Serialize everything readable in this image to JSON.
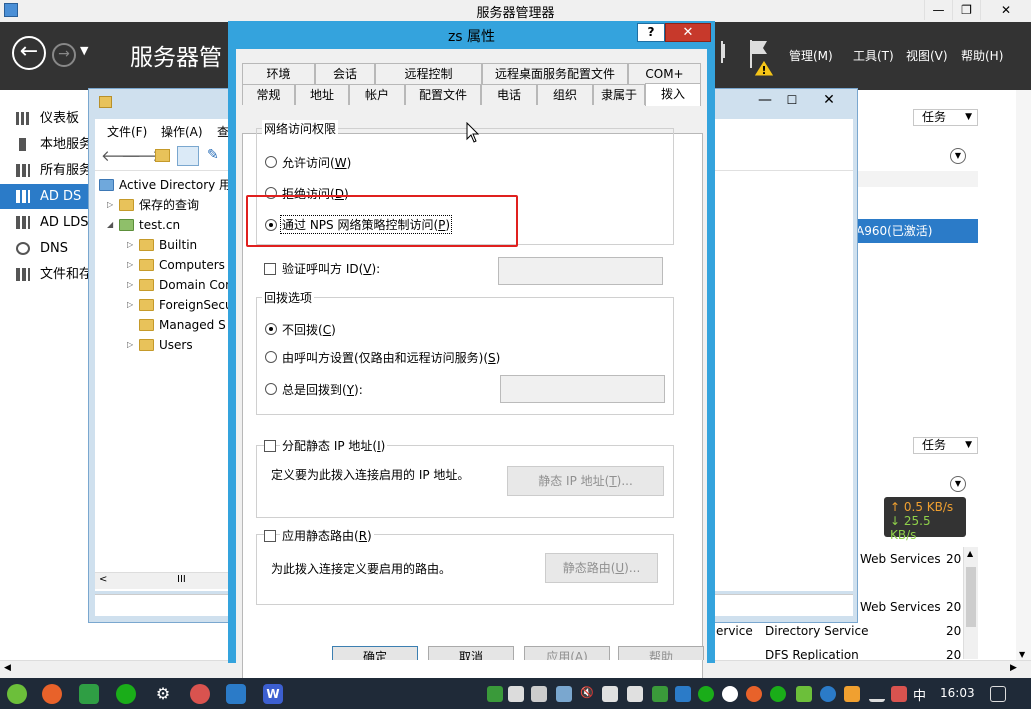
{
  "server_manager": {
    "window_title": "服务器管理器",
    "heading": "服务器管",
    "menu": [
      "管理(M)",
      "工具(T)",
      "视图(V)",
      "帮助(H)"
    ],
    "nav": [
      "仪表板",
      "本地服务",
      "所有服务",
      "AD DS",
      "AD LDS",
      "DNS",
      "文件和存"
    ],
    "tasks_label": "任务",
    "selected_server": "A960(已激活)",
    "net_up": "↑ 0.5 KB/s",
    "net_down": "↓ 25.5 KB/s",
    "services": [
      {
        "name": "Web Services",
        "num": "20"
      },
      {
        "name": "Web Services",
        "num": "20"
      },
      {
        "name": "ervice",
        "desc": "Directory Service",
        "num": "20"
      },
      {
        "name": "",
        "desc": "DFS Replication",
        "num": "20"
      }
    ]
  },
  "aduc": {
    "menu": [
      "文件(F)",
      "操作(A)",
      "查"
    ],
    "tree": [
      {
        "label": "Active Directory 用",
        "level": 0
      },
      {
        "label": "保存的查询",
        "level": 1
      },
      {
        "label": "test.cn",
        "level": 1
      },
      {
        "label": "Builtin",
        "level": 2
      },
      {
        "label": "Computers",
        "level": 2
      },
      {
        "label": "Domain Con",
        "level": 2
      },
      {
        "label": "ForeignSecu",
        "level": 2
      },
      {
        "label": "Managed S",
        "level": 2
      },
      {
        "label": "Users",
        "level": 2
      }
    ],
    "scroll_glyph": "III"
  },
  "dialog": {
    "title": "zs 属性",
    "help": "?",
    "close": "✕",
    "tabs_row1": [
      "环境",
      "会话",
      "远程控制",
      "远程桌面服务配置文件",
      "COM+"
    ],
    "tabs_row2": [
      "常规",
      "地址",
      "帐户",
      "配置文件",
      "电话",
      "组织",
      "隶属于",
      "拨入"
    ],
    "active_tab": "拨入",
    "network_access": {
      "title": "网络访问权限",
      "allow": {
        "text": "允许访问(",
        "key": "W",
        "end": ")"
      },
      "deny": {
        "text": "拒绝访问(",
        "key": "D",
        "end": ")"
      },
      "nps": {
        "text": "通过 NPS 网络策略控制访问(",
        "key": "P",
        "end": ")"
      },
      "selected": "nps"
    },
    "verify_caller": {
      "text": "验证呼叫方 ID(",
      "key": "V",
      "end": "):"
    },
    "callback": {
      "title": "回拨选项",
      "no_callback": {
        "text": "不回拨(",
        "key": "C",
        "end": ")"
      },
      "set_by_caller": {
        "text": "由呼叫方设置(仅路由和远程访问服务)(",
        "key": "S",
        "end": ")"
      },
      "always": {
        "text": "总是回拨到(",
        "key": "Y",
        "end": "):"
      }
    },
    "static_ip": {
      "label": {
        "text": "分配静态 IP 地址(",
        "key": "I",
        "end": ")"
      },
      "desc": "定义要为此拨入连接启用的 IP 地址。",
      "button": {
        "text": "静态 IP 地址(",
        "key": "T",
        "end": ")..."
      }
    },
    "static_routes": {
      "label": {
        "text": "应用静态路由(",
        "key": "R",
        "end": ")"
      },
      "desc": "为此拨入连接定义要启用的路由。",
      "button": {
        "text": "静态路由(",
        "key": "U",
        "end": ")..."
      }
    },
    "footer": [
      "确定",
      "取消",
      "应用(A)",
      "帮助"
    ]
  },
  "taskbar": {
    "time": "16:03",
    "ime": "中"
  },
  "colors": {
    "dialog_frame": "#34a3dd",
    "highlight_box": "#e0201e",
    "selection": "#2b7bc8",
    "sm_header": "#333333",
    "taskbar": "#1f2a38"
  }
}
